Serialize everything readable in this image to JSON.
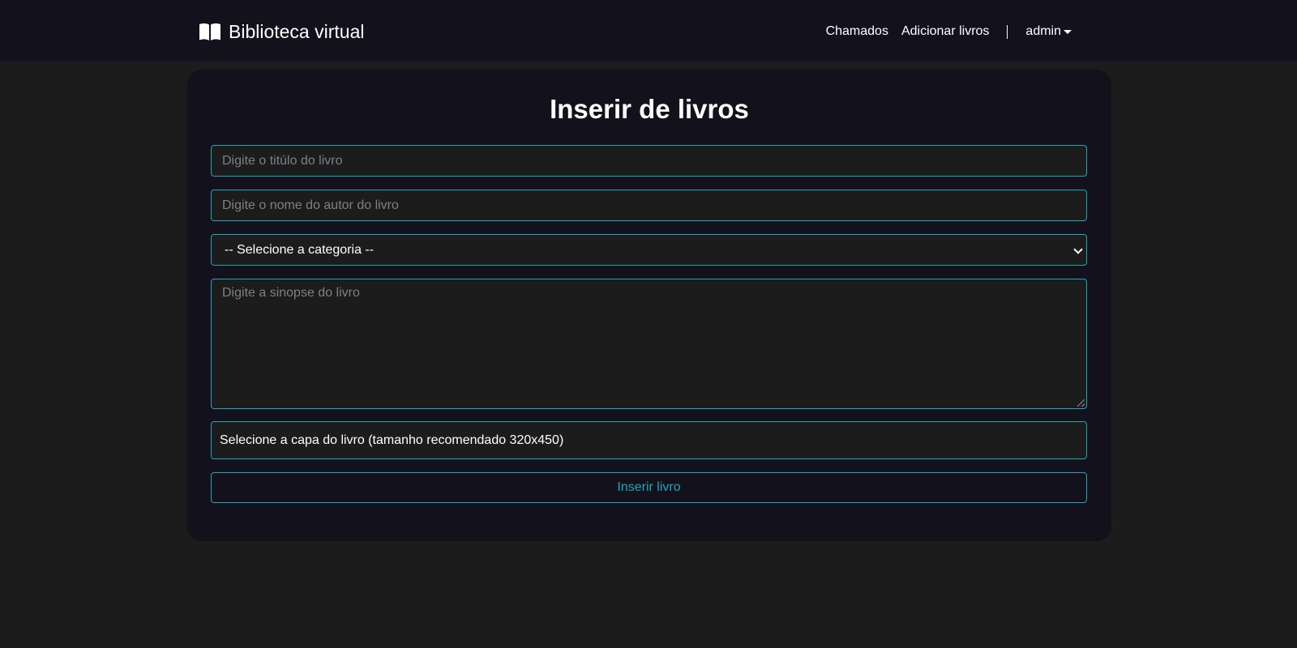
{
  "navbar": {
    "brand_label": "Biblioteca virtual",
    "brand_icon": "book-open-icon",
    "links": [
      {
        "label": "Chamados"
      },
      {
        "label": "Adicionar livros"
      }
    ],
    "user_label": "admin"
  },
  "form": {
    "title": "Inserir de livros",
    "title_placeholder": "Digite o titúlo do livro",
    "author_placeholder": "Digite o nome do autor do livro",
    "category_selected": "-- Selecione a categoria --",
    "synopsis_placeholder": "Digite a sinopse do livro",
    "cover_label": "Selecione a capa do livro (tamanho recomendado 320x450)",
    "submit_label": "Inserir livro"
  },
  "colors": {
    "background": "#1c1c1c",
    "navbar": "#12111c",
    "card": "#12111c",
    "accent": "#1ea5b8",
    "text": "#ffffff",
    "placeholder": "#7f7f86"
  }
}
